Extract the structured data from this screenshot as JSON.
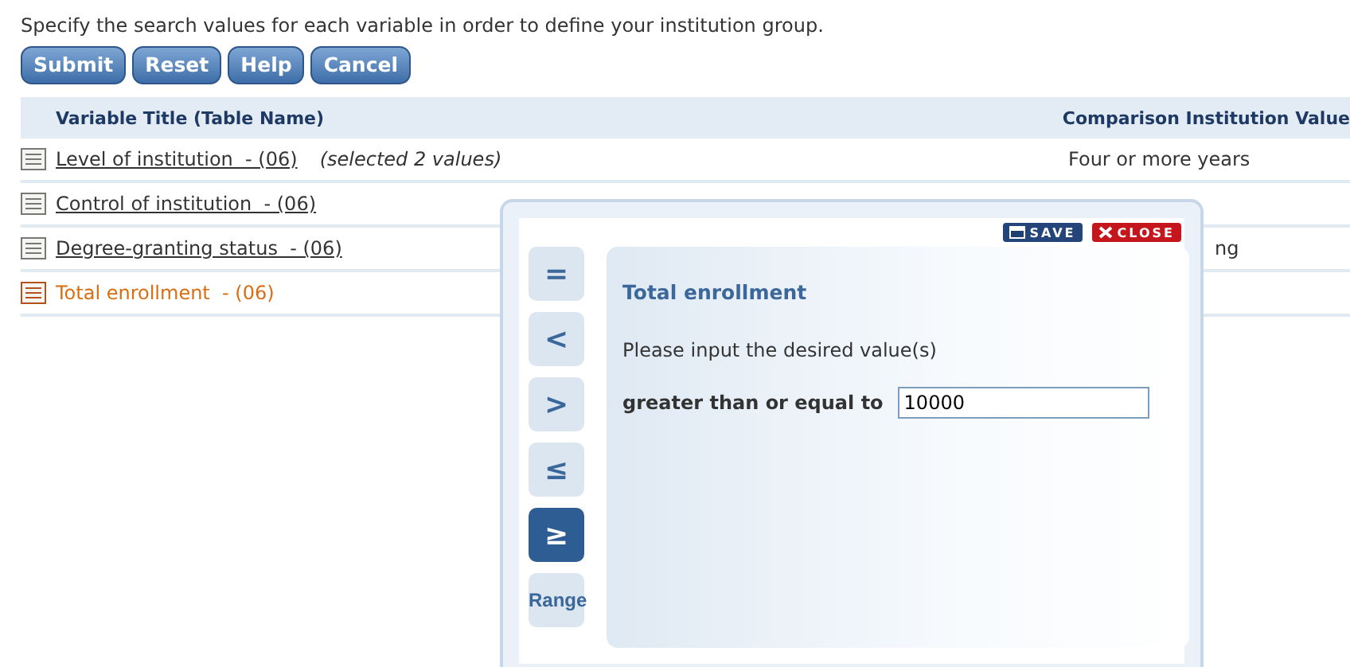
{
  "instructions": "Specify the search values for each variable in order to define your institution group.",
  "buttons": [
    "Submit",
    "Reset",
    "Help",
    "Cancel"
  ],
  "table": {
    "columns": [
      "Variable Title (Table Name)",
      "Comparison Institution Value"
    ],
    "rows": [
      {
        "title": "Level of institution  - (06)",
        "note": "(selected 2 values)",
        "value": "Four or more years",
        "selected": false
      },
      {
        "title": "Control of institution  - (06)",
        "selected": false
      },
      {
        "title": "Degree-granting status  - (06)",
        "value": "ng",
        "selected": false,
        "covered": true
      },
      {
        "title": "Total enrollment  - (06)",
        "selected": true
      }
    ]
  },
  "dialog": {
    "save": "SAVE",
    "close": "CLOSE",
    "title": "Total enrollment",
    "prompt": "Please input the desired value(s)",
    "operators": [
      {
        "label": "=",
        "selected": false
      },
      {
        "label": "<",
        "selected": false
      },
      {
        "label": ">",
        "selected": false
      },
      {
        "label": "≤",
        "selected": false
      },
      {
        "label": "≥",
        "selected": true
      },
      {
        "label": "Range",
        "selected": false
      }
    ],
    "field_label": "greater than or equal to",
    "field_value": "10000"
  }
}
